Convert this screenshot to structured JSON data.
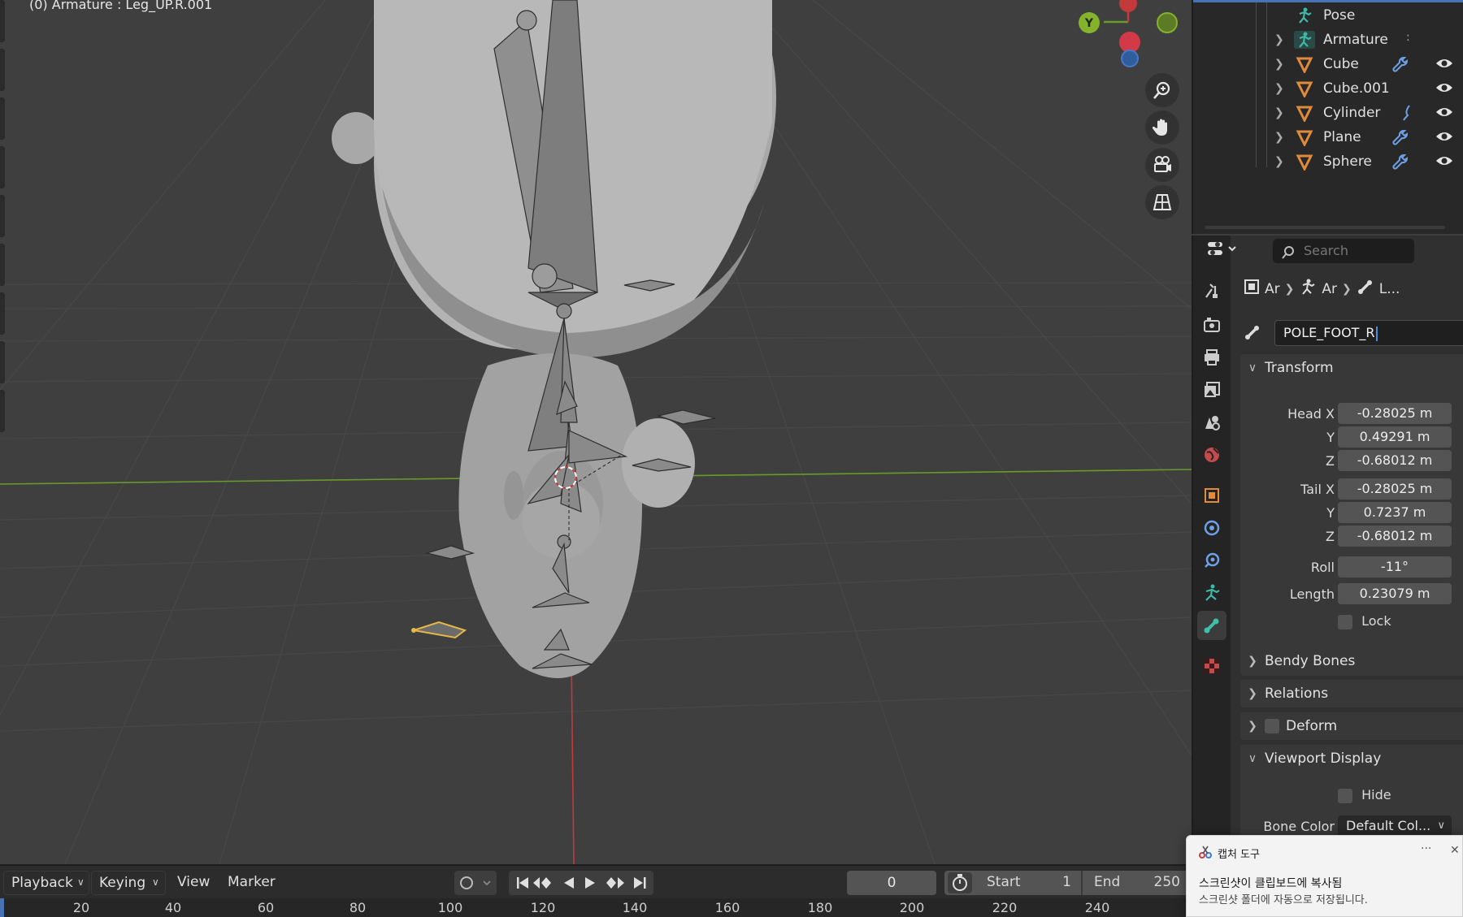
{
  "viewport": {
    "header_text": "(0) Armature : Leg_UP.R.001",
    "gizmo_y_label": "Y"
  },
  "outliner": {
    "items": [
      {
        "label": "Pose",
        "type": "pose"
      },
      {
        "label": "Armature",
        "type": "armature"
      },
      {
        "label": "Cube",
        "type": "mesh"
      },
      {
        "label": "Cube.001",
        "type": "mesh"
      },
      {
        "label": "Cylinder",
        "type": "mesh"
      },
      {
        "label": "Plane",
        "type": "mesh"
      },
      {
        "label": "Sphere",
        "type": "mesh"
      }
    ]
  },
  "properties": {
    "search_placeholder": "Search",
    "breadcrumb": [
      "Ar",
      "Ar",
      "L..."
    ],
    "bone_name": "POLE_FOOT_R",
    "transform": {
      "title": "Transform",
      "head_x_label": "Head X",
      "head_x": "-0.28025 m",
      "head_y_label": "Y",
      "head_y": "0.49291 m",
      "head_z_label": "Z",
      "head_z": "-0.68012 m",
      "tail_x_label": "Tail X",
      "tail_x": "-0.28025 m",
      "tail_y_label": "Y",
      "tail_y": "0.7237 m",
      "tail_z_label": "Z",
      "tail_z": "-0.68012 m",
      "roll_label": "Roll",
      "roll": "-11°",
      "length_label": "Length",
      "length": "0.23079 m",
      "lock_label": "Lock"
    },
    "panels": {
      "bendy_bones": "Bendy Bones",
      "relations": "Relations",
      "deform": "Deform",
      "viewport_display": "Viewport Display"
    },
    "viewport_display": {
      "hide_label": "Hide",
      "bone_color_label": "Bone Color",
      "bone_color_value": "Default Col..."
    }
  },
  "timeline": {
    "menus": [
      "Playback",
      "Keying",
      "View",
      "Marker"
    ],
    "current_frame": "0",
    "start_label": "Start",
    "start_value": "1",
    "end_label": "End",
    "end_value": "250",
    "ruler_ticks": [
      "20",
      "40",
      "60",
      "80",
      "100",
      "120",
      "140",
      "160",
      "180",
      "200",
      "220",
      "240"
    ]
  },
  "toast": {
    "app_name": "캡처 도구",
    "more": "···",
    "close": "✕",
    "message": "스크린샷이 클립보드에 복사됨",
    "detail": "스크린샷 폴더에 자동으로 저장됩니다."
  },
  "colors": {
    "axis_x": "#c33a3a",
    "axis_y": "#6a9a2a",
    "selected_bone": "#e6b84a",
    "accent_blue": "#4a90e2",
    "mesh_icon": "#e08a3c",
    "armature_icon": "#3fb8a8"
  }
}
